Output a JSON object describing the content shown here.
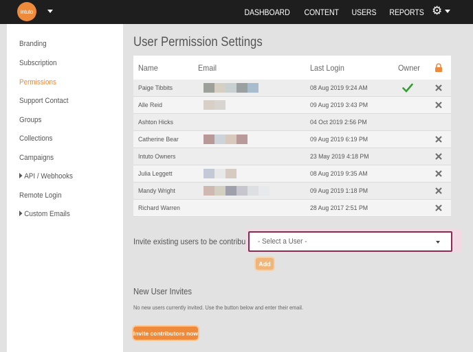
{
  "header": {
    "logo_text": "intuto",
    "nav": [
      "DASHBOARD",
      "CONTENT",
      "USERS",
      "REPORTS"
    ],
    "settings_icon": "gear-icon"
  },
  "sidebar": {
    "items": [
      {
        "label": "Branding"
      },
      {
        "label": "Subscription"
      },
      {
        "label": "Permissions",
        "active": true
      },
      {
        "label": "Support Contact"
      },
      {
        "label": "Groups"
      },
      {
        "label": "Collections"
      },
      {
        "label": "Campaigns"
      },
      {
        "label": "API / Webhooks",
        "expandable": true
      },
      {
        "label": "Remote Login"
      },
      {
        "label": "Custom Emails",
        "expandable": true
      }
    ]
  },
  "main": {
    "title": "User Permission Settings",
    "table": {
      "headers": {
        "name": "Name",
        "email": "Email",
        "last_login": "Last Login",
        "owner": "Owner"
      },
      "rows": [
        {
          "name": "Paige Tibbits",
          "last_login": "08 Aug 2019 9:24 AM",
          "owner": true,
          "removable": true
        },
        {
          "name": "Alle Reid",
          "last_login": "09 Aug 2019 3:43 PM",
          "owner": false,
          "removable": true
        },
        {
          "name": "Ashton Hicks",
          "last_login": "04 Oct 2019 2:56 PM",
          "owner": false,
          "removable": false
        },
        {
          "name": "Catherine Bear",
          "last_login": "09 Aug 2019 6:19 PM",
          "owner": false,
          "removable": true
        },
        {
          "name": "Intuto Owners",
          "last_login": "23 May 2019 4:18 PM",
          "owner": false,
          "removable": true
        },
        {
          "name": "Julia Leggett",
          "last_login": "08 Aug 2019 9:35 AM",
          "owner": false,
          "removable": true
        },
        {
          "name": "Mandy Wright",
          "last_login": "09 Aug 2019 1:18 PM",
          "owner": false,
          "removable": true
        },
        {
          "name": "Richard Warren",
          "last_login": "28 Aug 2017 2:51 PM",
          "owner": false,
          "removable": true
        }
      ]
    },
    "invite": {
      "label": "Invite existing users to be contributors",
      "select_value": "- Select a User -",
      "add_label": "Add"
    },
    "new_invites": {
      "title": "New User Invites",
      "note": "No new users currently invited. Use the button below and enter their email.",
      "button_label": "Invite contributors now"
    }
  },
  "colors": {
    "accent": "#ee8a3a",
    "topbar": "#1e1e1e",
    "check": "#2ea02e",
    "select_border": "#8b2a50"
  }
}
